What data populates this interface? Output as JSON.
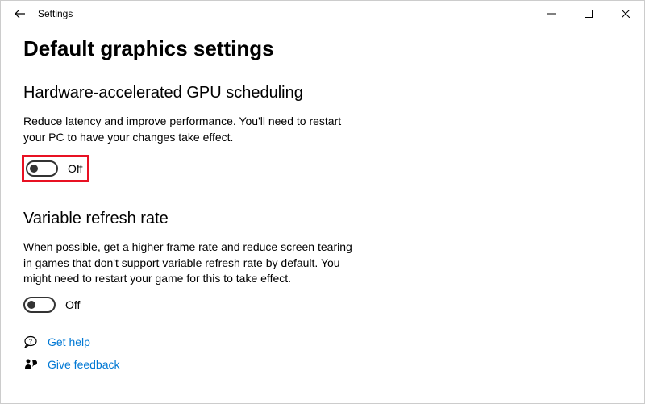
{
  "titlebar": {
    "app_name": "Settings"
  },
  "page": {
    "title": "Default graphics settings"
  },
  "gpu_scheduling": {
    "heading": "Hardware-accelerated GPU scheduling",
    "description": "Reduce latency and improve performance. You'll need to restart your PC to have your changes take effect.",
    "toggle_state": "Off",
    "highlighted": true
  },
  "vrr": {
    "heading": "Variable refresh rate",
    "description": "When possible, get a higher frame rate and reduce screen tearing in games that don't support variable refresh rate by default. You might need to restart your game for this to take effect.",
    "toggle_state": "Off"
  },
  "links": {
    "get_help": "Get help",
    "give_feedback": "Give feedback"
  },
  "colors": {
    "highlight": "#e81123",
    "link": "#0078d4"
  }
}
